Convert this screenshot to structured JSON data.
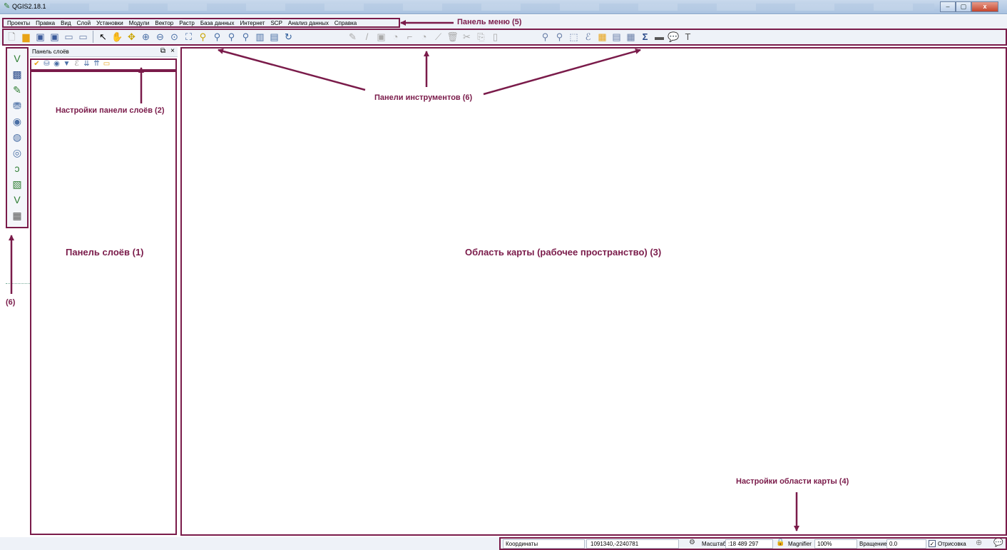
{
  "window": {
    "title": "QGIS2.18.1",
    "app_icon": "qgis-logo-icon",
    "minimize_label": "–",
    "maximize_label": "▢",
    "close_label": "x"
  },
  "menu": {
    "items": [
      "Проекты",
      "Правка",
      "Вид",
      "Слой",
      "Установки",
      "Модули",
      "Вектор",
      "Растр",
      "База данных",
      "Интернет",
      "SCP",
      "Анализ данных",
      "Справка"
    ]
  },
  "layers_panel": {
    "title": "Панель слоёв",
    "float_icon": "float-icon",
    "close_icon": "close-icon"
  },
  "status": {
    "coords_label": "Координаты",
    "coords_value": "1091340,-2240781",
    "scale_label": "Масштаб",
    "scale_value": ":18 489 297",
    "magnifier_label": "Magnifier",
    "magnifier_value": "100%",
    "rotation_label": "Вращение",
    "rotation_value": "0.0",
    "render_label": "Отрисовка",
    "render_checked": true
  },
  "annotations": {
    "menu_panel": "Панель меню (5)",
    "toolbars": "Панели инструментов (6)",
    "layers_settings": "Настройки панели слоёв (2)",
    "layers_panel": "Панель слоёв (1)",
    "map_area": "Область карты (рабочее пространство) (3)",
    "map_settings": "Настройки области карты (4)",
    "left_toolbar": "(6)"
  },
  "colors": {
    "annotation": "#7a1b4a",
    "chrome": "#eef2f8",
    "titlebar": "#b9cde6"
  }
}
